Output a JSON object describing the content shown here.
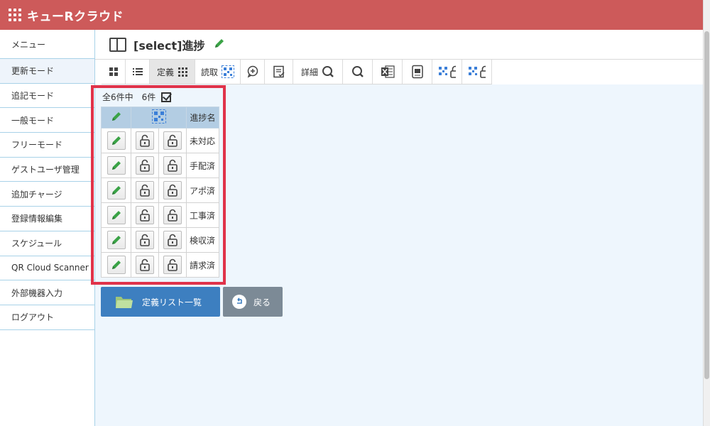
{
  "app": {
    "title": "キューRクラウド"
  },
  "sidebar": {
    "items": [
      {
        "label": "メニュー",
        "name": "sidebar-item-menu"
      },
      {
        "label": "更新モード",
        "name": "sidebar-item-update-mode"
      },
      {
        "label": "追記モード",
        "name": "sidebar-item-append-mode"
      },
      {
        "label": "一般モード",
        "name": "sidebar-item-general-mode"
      },
      {
        "label": "フリーモード",
        "name": "sidebar-item-free-mode"
      },
      {
        "label": "ゲストユーザ管理",
        "name": "sidebar-item-guest-user-admin"
      },
      {
        "label": "追加チャージ",
        "name": "sidebar-item-additional-charge"
      },
      {
        "label": "登録情報編集",
        "name": "sidebar-item-edit-registration"
      },
      {
        "label": "スケジュール",
        "name": "sidebar-item-schedule"
      },
      {
        "label": "QR Cloud Scanner",
        "name": "sidebar-item-qr-cloud-scanner"
      },
      {
        "label": "外部機器入力",
        "name": "sidebar-item-external-device-input"
      },
      {
        "label": "ログアウト",
        "name": "sidebar-item-logout"
      }
    ],
    "active_index": 1
  },
  "page": {
    "title": "[select]進捗"
  },
  "toolbar": {
    "teigi_label": "定義",
    "yomitori_label": "読取",
    "shosai_label": "詳細"
  },
  "list": {
    "count_total": "全6件中",
    "count_shown": "6件",
    "column_name": "進捗名",
    "rows": [
      "未対応",
      "手配済",
      "アポ済",
      "工事済",
      "検収済",
      "請求済"
    ]
  },
  "buttons": {
    "definition_list": "定義リスト一覧",
    "back": "戻る"
  },
  "colors": {
    "header": "#cd5a5a",
    "pencil": "#3aa346",
    "qr_blue": "#3b7fd8",
    "highlight": "#e0334a",
    "primary_button": "#3d7fc0",
    "secondary_button": "#7c8a96"
  }
}
